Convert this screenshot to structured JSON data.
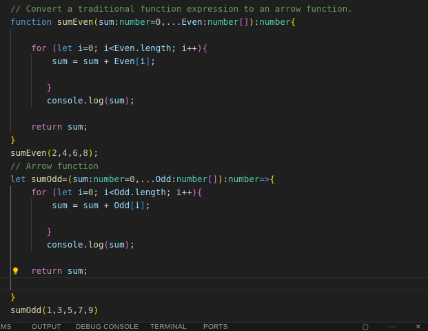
{
  "editor": {
    "lines": [
      [
        {
          "t": "// Convert a traditional function expression to an arrow function.",
          "c": "comment"
        }
      ],
      [
        {
          "t": "function ",
          "c": "keyword"
        },
        {
          "t": "sumEven",
          "c": "fn"
        },
        {
          "t": "(",
          "c": "brace-yellow"
        },
        {
          "t": "sum",
          "c": "var"
        },
        {
          "t": ":",
          "c": "punct"
        },
        {
          "t": "number",
          "c": "type"
        },
        {
          "t": "=",
          "c": "punct"
        },
        {
          "t": "0",
          "c": "num"
        },
        {
          "t": ",...",
          "c": "punct"
        },
        {
          "t": "Even",
          "c": "var"
        },
        {
          "t": ":",
          "c": "punct"
        },
        {
          "t": "number",
          "c": "type"
        },
        {
          "t": "[]",
          "c": "brace-purple"
        },
        {
          "t": ")",
          "c": "brace-yellow"
        },
        {
          "t": ":",
          "c": "punct"
        },
        {
          "t": "number",
          "c": "type"
        },
        {
          "t": "{",
          "c": "brace-yellow"
        }
      ],
      [],
      [
        {
          "t": "    ",
          "c": "punct"
        },
        {
          "t": "for",
          "c": "control"
        },
        {
          "t": " ",
          "c": "punct"
        },
        {
          "t": "(",
          "c": "brace-purple"
        },
        {
          "t": "let ",
          "c": "keyword"
        },
        {
          "t": "i",
          "c": "var"
        },
        {
          "t": "=",
          "c": "punct"
        },
        {
          "t": "0",
          "c": "num"
        },
        {
          "t": "; ",
          "c": "punct"
        },
        {
          "t": "i",
          "c": "var"
        },
        {
          "t": "<",
          "c": "punct"
        },
        {
          "t": "Even",
          "c": "var"
        },
        {
          "t": ".",
          "c": "punct"
        },
        {
          "t": "length",
          "c": "var"
        },
        {
          "t": "; ",
          "c": "punct"
        },
        {
          "t": "i",
          "c": "var"
        },
        {
          "t": "++",
          "c": "punct"
        },
        {
          "t": ")",
          "c": "brace-purple"
        },
        {
          "t": "{",
          "c": "brace-purple"
        }
      ],
      [
        {
          "t": "        ",
          "c": "punct"
        },
        {
          "t": "sum",
          "c": "var"
        },
        {
          "t": " = ",
          "c": "punct"
        },
        {
          "t": "sum",
          "c": "var"
        },
        {
          "t": " + ",
          "c": "punct"
        },
        {
          "t": "Even",
          "c": "var"
        },
        {
          "t": "[",
          "c": "brace-blue"
        },
        {
          "t": "i",
          "c": "var"
        },
        {
          "t": "]",
          "c": "brace-blue"
        },
        {
          "t": ";",
          "c": "punct"
        }
      ],
      [],
      [
        {
          "t": "       ",
          "c": "punct"
        },
        {
          "t": "}",
          "c": "brace-purple"
        }
      ],
      [
        {
          "t": "       ",
          "c": "punct"
        },
        {
          "t": "console",
          "c": "var"
        },
        {
          "t": ".",
          "c": "punct"
        },
        {
          "t": "log",
          "c": "fn"
        },
        {
          "t": "(",
          "c": "brace-purple"
        },
        {
          "t": "sum",
          "c": "var"
        },
        {
          "t": ")",
          "c": "brace-purple"
        },
        {
          "t": ";",
          "c": "punct"
        }
      ],
      [],
      [
        {
          "t": "    ",
          "c": "punct"
        },
        {
          "t": "return",
          "c": "control"
        },
        {
          "t": " ",
          "c": "punct"
        },
        {
          "t": "sum",
          "c": "var"
        },
        {
          "t": ";",
          "c": "punct"
        }
      ],
      [
        {
          "t": "}",
          "c": "brace-yellow"
        }
      ],
      [
        {
          "t": "sumEven",
          "c": "fn"
        },
        {
          "t": "(",
          "c": "brace-yellow"
        },
        {
          "t": "2",
          "c": "num"
        },
        {
          "t": ",",
          "c": "punct"
        },
        {
          "t": "4",
          "c": "num"
        },
        {
          "t": ",",
          "c": "punct"
        },
        {
          "t": "6",
          "c": "num"
        },
        {
          "t": ",",
          "c": "punct"
        },
        {
          "t": "8",
          "c": "num"
        },
        {
          "t": ")",
          "c": "brace-yellow"
        },
        {
          "t": ";",
          "c": "punct"
        }
      ],
      [
        {
          "t": "// Arrow function",
          "c": "comment"
        }
      ],
      [
        {
          "t": "let ",
          "c": "keyword"
        },
        {
          "t": "sumOdd",
          "c": "fn"
        },
        {
          "t": "=",
          "c": "punct"
        },
        {
          "t": "(",
          "c": "brace-yellow"
        },
        {
          "t": "sum",
          "c": "var"
        },
        {
          "t": ":",
          "c": "punct"
        },
        {
          "t": "number",
          "c": "type"
        },
        {
          "t": "=",
          "c": "punct"
        },
        {
          "t": "0",
          "c": "num"
        },
        {
          "t": ",...",
          "c": "punct"
        },
        {
          "t": "Odd",
          "c": "var"
        },
        {
          "t": ":",
          "c": "punct"
        },
        {
          "t": "number",
          "c": "type"
        },
        {
          "t": "[]",
          "c": "brace-purple"
        },
        {
          "t": ")",
          "c": "brace-yellow"
        },
        {
          "t": ":",
          "c": "punct"
        },
        {
          "t": "number",
          "c": "type"
        },
        {
          "t": "=>",
          "c": "keyword"
        },
        {
          "t": "{",
          "c": "brace-yellow"
        }
      ],
      [
        {
          "t": "    ",
          "c": "punct"
        },
        {
          "t": "for",
          "c": "control"
        },
        {
          "t": " ",
          "c": "punct"
        },
        {
          "t": "(",
          "c": "brace-purple"
        },
        {
          "t": "let ",
          "c": "keyword"
        },
        {
          "t": "i",
          "c": "var"
        },
        {
          "t": "=",
          "c": "punct"
        },
        {
          "t": "0",
          "c": "num"
        },
        {
          "t": "; ",
          "c": "punct"
        },
        {
          "t": "i",
          "c": "var"
        },
        {
          "t": "<",
          "c": "punct"
        },
        {
          "t": "Odd",
          "c": "var"
        },
        {
          "t": ".",
          "c": "punct"
        },
        {
          "t": "length",
          "c": "var"
        },
        {
          "t": "; ",
          "c": "punct"
        },
        {
          "t": "i",
          "c": "var"
        },
        {
          "t": "++",
          "c": "punct"
        },
        {
          "t": ")",
          "c": "brace-purple"
        },
        {
          "t": "{",
          "c": "brace-purple"
        }
      ],
      [
        {
          "t": "        ",
          "c": "punct"
        },
        {
          "t": "sum",
          "c": "var"
        },
        {
          "t": " = ",
          "c": "punct"
        },
        {
          "t": "sum",
          "c": "var"
        },
        {
          "t": " + ",
          "c": "punct"
        },
        {
          "t": "Odd",
          "c": "var"
        },
        {
          "t": "[",
          "c": "brace-blue"
        },
        {
          "t": "i",
          "c": "var"
        },
        {
          "t": "]",
          "c": "brace-blue"
        },
        {
          "t": ";",
          "c": "punct"
        }
      ],
      [],
      [
        {
          "t": "       ",
          "c": "punct"
        },
        {
          "t": "}",
          "c": "brace-purple"
        }
      ],
      [
        {
          "t": "       ",
          "c": "punct"
        },
        {
          "t": "console",
          "c": "var"
        },
        {
          "t": ".",
          "c": "punct"
        },
        {
          "t": "log",
          "c": "fn"
        },
        {
          "t": "(",
          "c": "brace-purple"
        },
        {
          "t": "sum",
          "c": "var"
        },
        {
          "t": ")",
          "c": "brace-purple"
        },
        {
          "t": ";",
          "c": "punct"
        }
      ],
      [],
      [
        {
          "t": "    ",
          "c": "punct"
        },
        {
          "t": "return",
          "c": "control"
        },
        {
          "t": " ",
          "c": "punct"
        },
        {
          "t": "sum",
          "c": "var"
        },
        {
          "t": ";",
          "c": "punct"
        }
      ],
      [],
      [
        {
          "t": "}",
          "c": "brace-yellow"
        }
      ],
      [
        {
          "t": "sumOdd",
          "c": "fn"
        },
        {
          "t": "(",
          "c": "brace-yellow"
        },
        {
          "t": "1",
          "c": "num"
        },
        {
          "t": ",",
          "c": "punct"
        },
        {
          "t": "3",
          "c": "num"
        },
        {
          "t": ",",
          "c": "punct"
        },
        {
          "t": "5",
          "c": "num"
        },
        {
          "t": ",",
          "c": "punct"
        },
        {
          "t": "7",
          "c": "num"
        },
        {
          "t": ",",
          "c": "punct"
        },
        {
          "t": "9",
          "c": "num"
        },
        {
          "t": ")",
          "c": "brace-yellow"
        }
      ]
    ],
    "lightbulb_icon": "lightbulb-icon",
    "colors": {
      "background": "#1f1f1f",
      "comment": "#6a9955",
      "keyword": "#569cd6",
      "control": "#c586c0",
      "function": "#dcdcaa",
      "variable": "#9cdcfe",
      "type": "#4ec9b0",
      "number": "#b5cea8"
    }
  },
  "panel": {
    "tabs": [
      "EMS",
      "OUTPUT",
      "DEBUG CONSOLE",
      "TERMINAL",
      "PORTS"
    ],
    "icons": [
      "maximize-icon",
      "more-icon",
      "close-icon"
    ]
  }
}
